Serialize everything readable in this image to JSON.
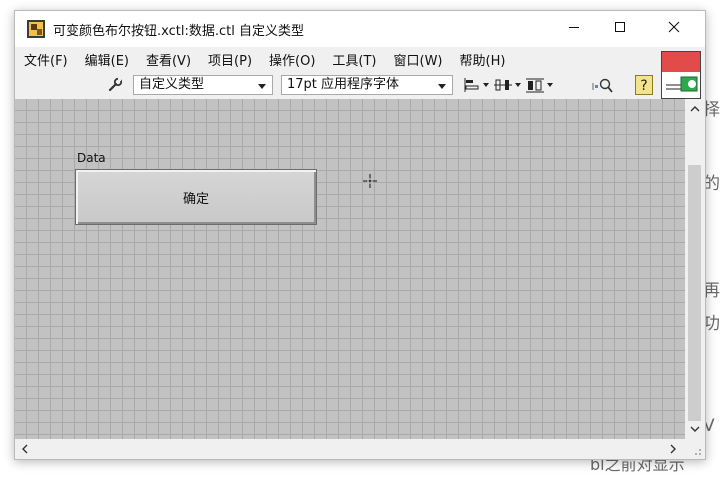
{
  "window": {
    "title": "可变颜色布尔按钮.xctl:数据.ctl 自定义类型"
  },
  "menu": [
    {
      "label": "文件(F)"
    },
    {
      "label": "编辑(E)"
    },
    {
      "label": "查看(V)"
    },
    {
      "label": "项目(P)"
    },
    {
      "label": "操作(O)"
    },
    {
      "label": "工具(T)"
    },
    {
      "label": "窗口(W)"
    },
    {
      "label": "帮助(H)"
    }
  ],
  "toolbar": {
    "type_select": "自定义类型",
    "font_select": "17pt 应用程序字体"
  },
  "panel": {
    "control_label": "Data",
    "button_text": "确定"
  },
  "background": {
    "fragments": [
      "择",
      "的",
      "再",
      "功",
      "V",
      "bl之前对显示"
    ]
  },
  "colors": {
    "canvas_bg": "#c2c2c2",
    "grid_line": "#a9a9a9",
    "button_face": "#d0d0d0"
  }
}
